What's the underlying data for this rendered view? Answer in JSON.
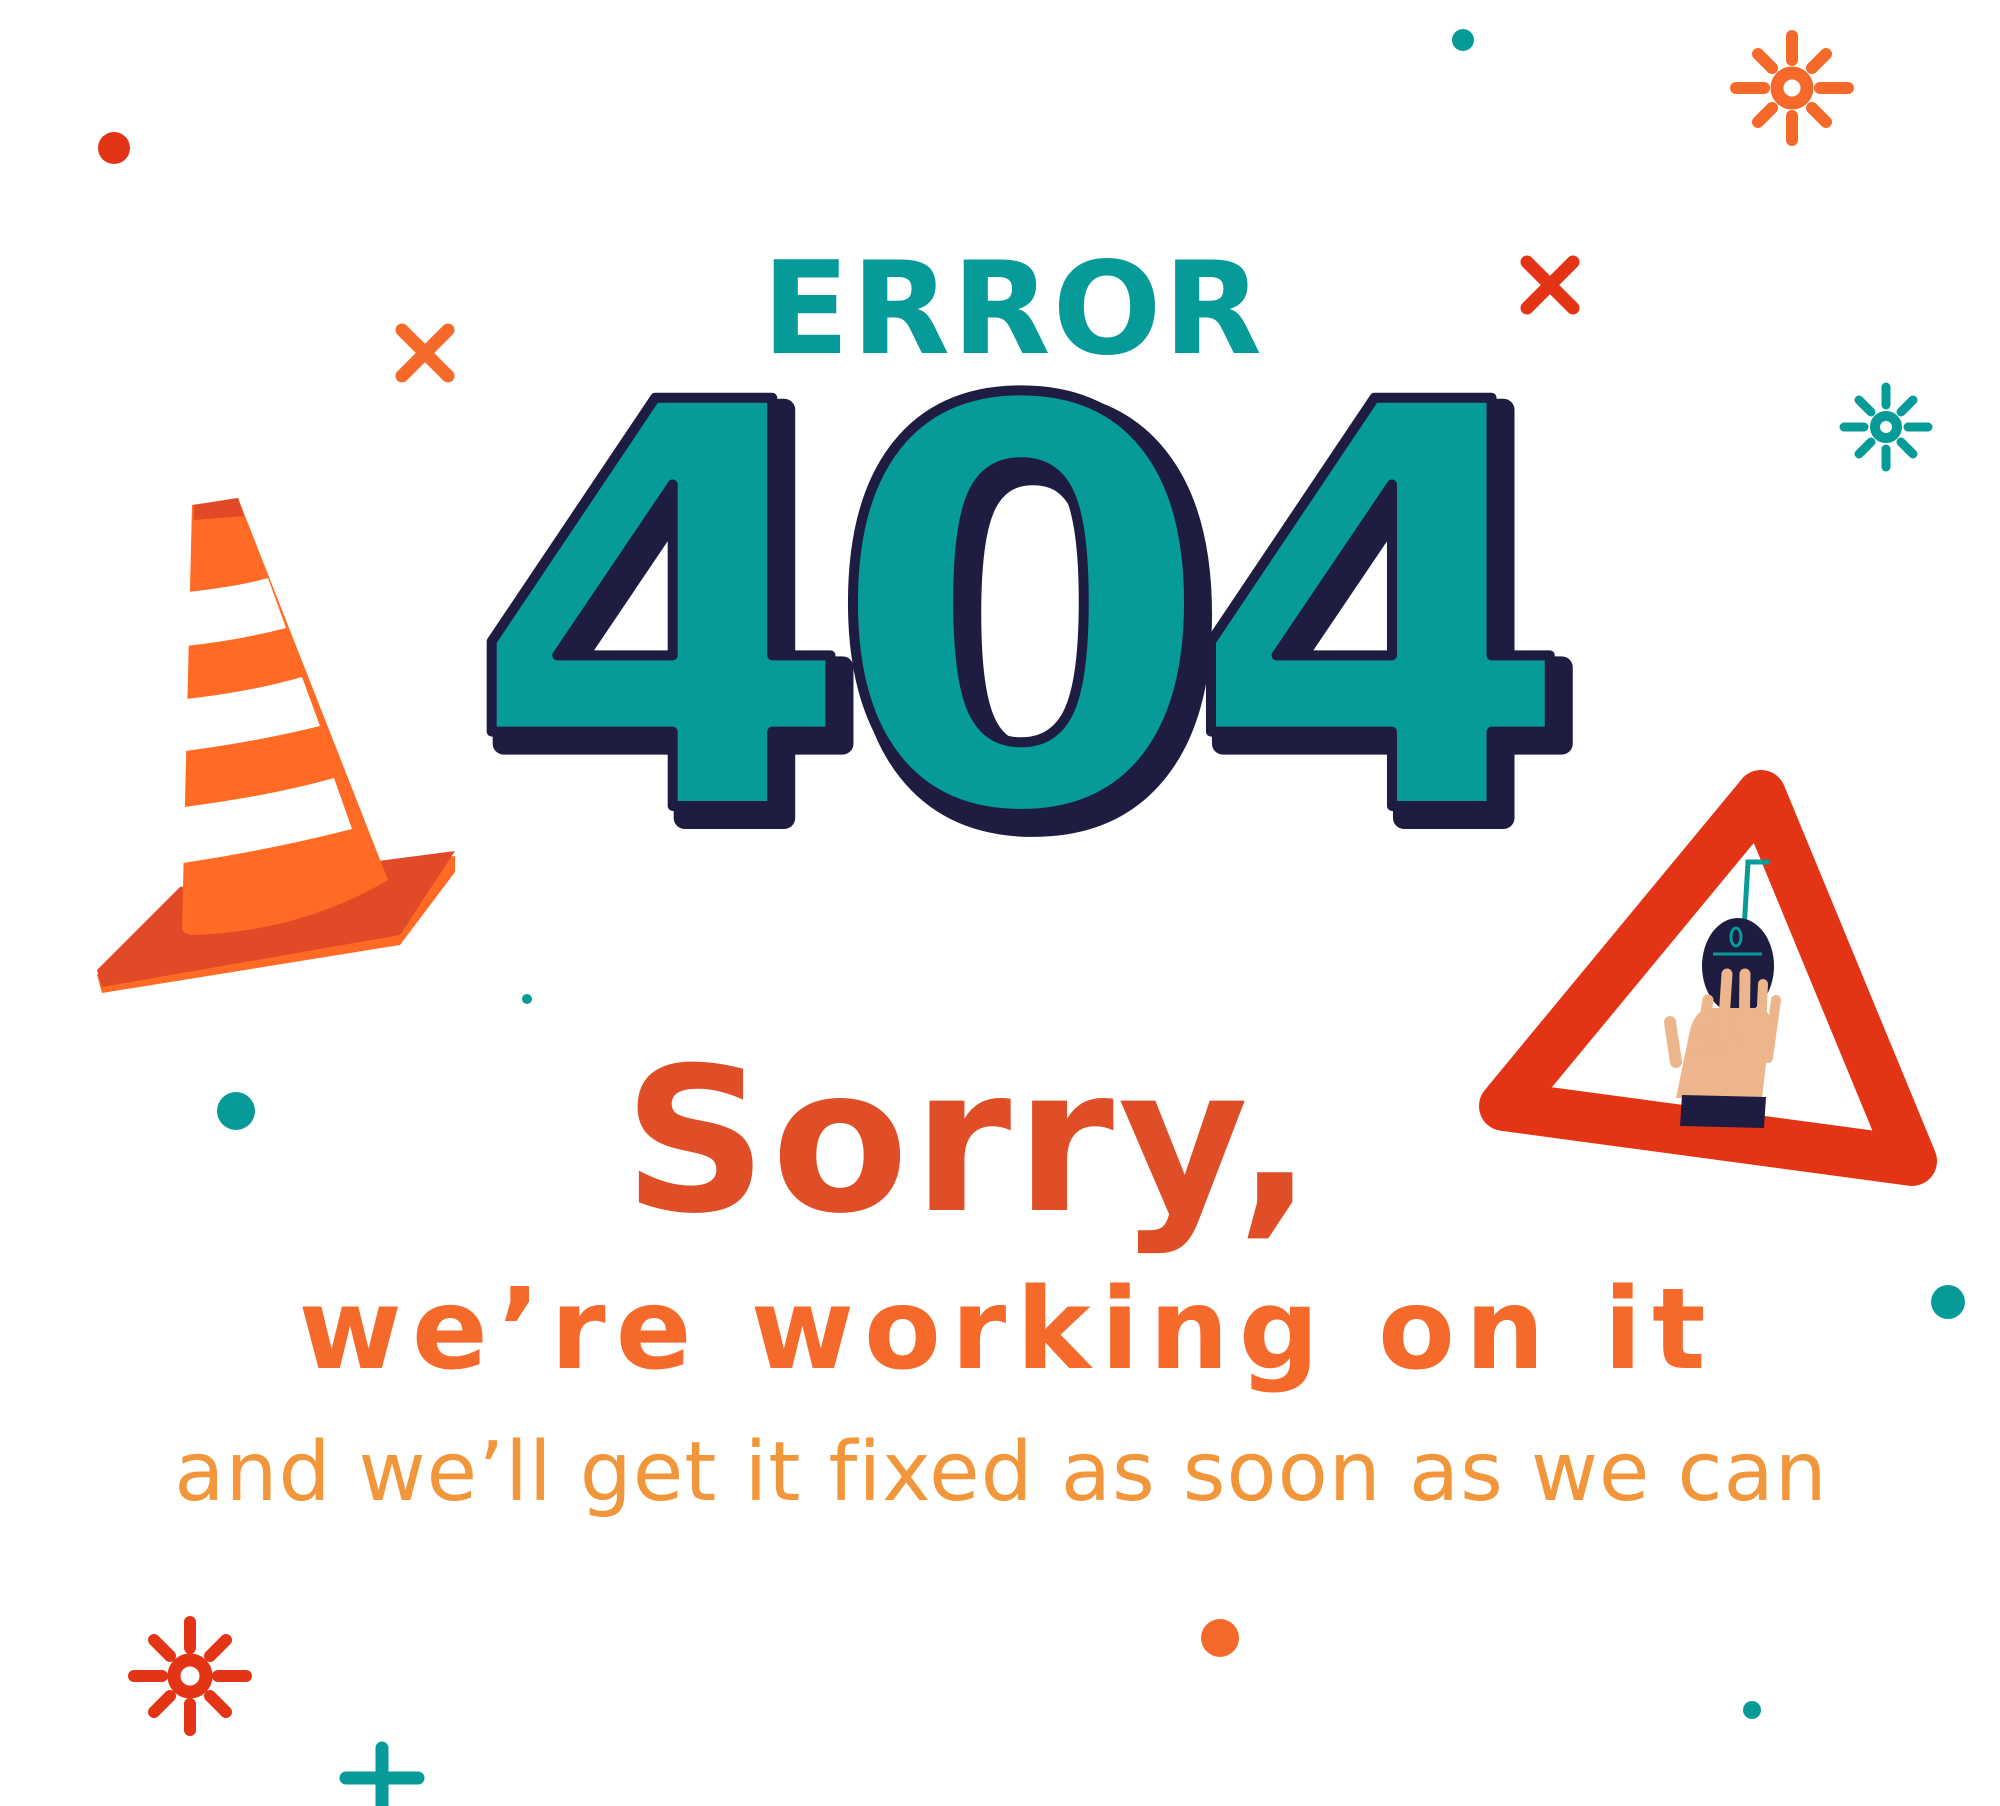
{
  "error_label": "ERROR",
  "code": "404",
  "headline": "Sorry,",
  "subheadline": "we’re working on it",
  "message": "and we’ll get it fixed as soon as we can",
  "icons": {
    "traffic_cone": "traffic-cone-icon",
    "warning_sign": "warning-sign-icon",
    "hand_with_mouse": "hand-with-mouse-icon"
  },
  "colors": {
    "teal": "#069A99",
    "navy": "#1E1C41",
    "red_orange": "#E04E27",
    "orange": "#F56A2B",
    "light_orange": "#F1963A",
    "cone_orange": "#FF6B24",
    "cone_dark": "#E14A26",
    "sign_red": "#E33515",
    "skin": "#EDB58C"
  }
}
